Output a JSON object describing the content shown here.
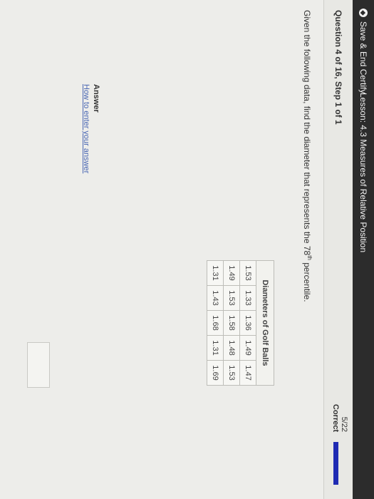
{
  "header": {
    "save_label": "Save & End Certify",
    "lesson_title": "Lesson: 4.3 Measures of Relative Position"
  },
  "question": {
    "label": "Question 4 of 16, Step 1 of 1",
    "score": "5/22",
    "status": "Correct",
    "prompt_before": "Given the following data, find the diameter that represents the 78",
    "prompt_sup": "th",
    "prompt_after": " percentile."
  },
  "table": {
    "title": "Diameters of Golf Balls",
    "rows": [
      [
        "1.53",
        "1.33",
        "1.36",
        "1.49",
        "1.47"
      ],
      [
        "1.49",
        "1.53",
        "1.58",
        "1.48",
        "1.53"
      ],
      [
        "1.31",
        "1.43",
        "1.68",
        "1.31",
        "1.69"
      ]
    ]
  },
  "answer": {
    "label": "Answer",
    "help_link": "How to enter your answer",
    "value": ""
  },
  "colors": {
    "topbar": "#2c2c2c",
    "progress": "#1f2bb3",
    "link": "#4a67b3"
  }
}
